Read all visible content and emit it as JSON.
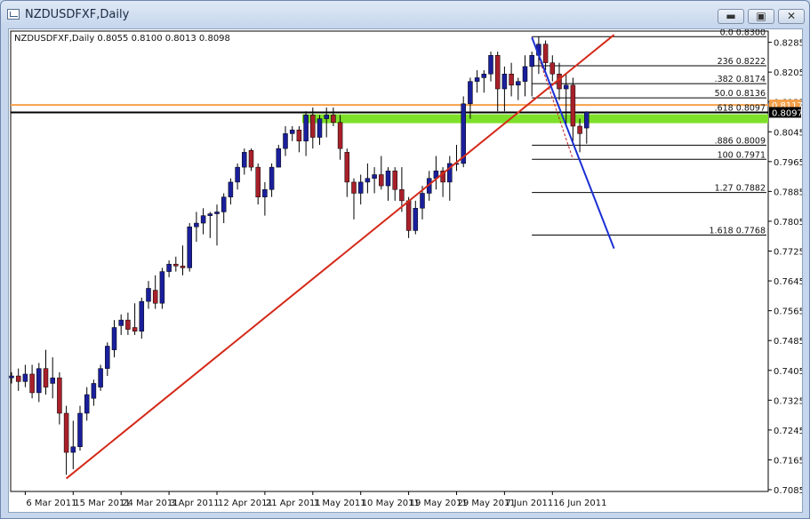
{
  "window": {
    "title": "NZDUSDFXF,Daily",
    "minimize_label": "▬",
    "restore_label": "▣",
    "close_label": "✕"
  },
  "chart_data": {
    "type": "candlestick",
    "header": "NZDUSDFXF,Daily  0.8055 0.8100 0.8013 0.8098",
    "symbol": "NZDUSDFXF",
    "timeframe": "Daily",
    "ylim": [
      0.7085,
      0.8315
    ],
    "y_ticks": [
      0.8285,
      0.8205,
      0.8125,
      0.8045,
      0.7965,
      0.7885,
      0.7805,
      0.7725,
      0.7645,
      0.7565,
      0.7485,
      0.7405,
      0.7325,
      0.7245,
      0.7165,
      0.7085
    ],
    "x_labels": [
      {
        "idx": 2,
        "label": "6 Mar 2011"
      },
      {
        "idx": 9,
        "label": "15 Mar 2011"
      },
      {
        "idx": 16,
        "label": "24 Mar 2011"
      },
      {
        "idx": 23,
        "label": "3 Apr 2011"
      },
      {
        "idx": 30,
        "label": "12 Apr 2011"
      },
      {
        "idx": 37,
        "label": "21 Apr 2011"
      },
      {
        "idx": 44,
        "label": "1 May 2011"
      },
      {
        "idx": 51,
        "label": "10 May 2011"
      },
      {
        "idx": 58,
        "label": "19 May 2011"
      },
      {
        "idx": 65,
        "label": "29 May 2011"
      },
      {
        "idx": 72,
        "label": "7 Jun 2011"
      },
      {
        "idx": 79,
        "label": "16 Jun 2011"
      }
    ],
    "candles": [
      [
        0.7385,
        0.74,
        0.737,
        0.739
      ],
      [
        0.739,
        0.741,
        0.735,
        0.7375
      ],
      [
        0.7375,
        0.742,
        0.736,
        0.7395
      ],
      [
        0.7395,
        0.742,
        0.733,
        0.7345
      ],
      [
        0.7345,
        0.7425,
        0.732,
        0.741
      ],
      [
        0.741,
        0.746,
        0.734,
        0.736
      ],
      [
        0.737,
        0.744,
        0.733,
        0.7385
      ],
      [
        0.7385,
        0.74,
        0.726,
        0.729
      ],
      [
        0.729,
        0.731,
        0.7125,
        0.7185
      ],
      [
        0.7185,
        0.727,
        0.714,
        0.72
      ],
      [
        0.72,
        0.731,
        0.719,
        0.729
      ],
      [
        0.729,
        0.736,
        0.727,
        0.734
      ],
      [
        0.733,
        0.738,
        0.731,
        0.737
      ],
      [
        0.736,
        0.742,
        0.735,
        0.741
      ],
      [
        0.741,
        0.748,
        0.739,
        0.747
      ],
      [
        0.746,
        0.754,
        0.744,
        0.752
      ],
      [
        0.7525,
        0.7555,
        0.75,
        0.754
      ],
      [
        0.754,
        0.756,
        0.75,
        0.7515
      ],
      [
        0.752,
        0.7585,
        0.75,
        0.751
      ],
      [
        0.751,
        0.76,
        0.749,
        0.759
      ],
      [
        0.759,
        0.7645,
        0.757,
        0.7625
      ],
      [
        0.762,
        0.766,
        0.757,
        0.7585
      ],
      [
        0.7585,
        0.768,
        0.757,
        0.767
      ],
      [
        0.767,
        0.77,
        0.7655,
        0.769
      ],
      [
        0.769,
        0.771,
        0.767,
        0.7685
      ],
      [
        0.7685,
        0.774,
        0.766,
        0.768
      ],
      [
        0.768,
        0.78,
        0.767,
        0.779
      ],
      [
        0.779,
        0.783,
        0.775,
        0.78
      ],
      [
        0.78,
        0.784,
        0.777,
        0.782
      ],
      [
        0.782,
        0.783,
        0.776,
        0.7825
      ],
      [
        0.7825,
        0.785,
        0.774,
        0.783
      ],
      [
        0.783,
        0.788,
        0.78,
        0.787
      ],
      [
        0.787,
        0.792,
        0.785,
        0.791
      ],
      [
        0.791,
        0.796,
        0.789,
        0.795
      ],
      [
        0.795,
        0.8,
        0.793,
        0.799
      ],
      [
        0.7995,
        0.8,
        0.794,
        0.795
      ],
      [
        0.795,
        0.796,
        0.785,
        0.787
      ],
      [
        0.787,
        0.791,
        0.782,
        0.789
      ],
      [
        0.789,
        0.796,
        0.787,
        0.795
      ],
      [
        0.795,
        0.801,
        0.795,
        0.8
      ],
      [
        0.8,
        0.806,
        0.798,
        0.804
      ],
      [
        0.804,
        0.806,
        0.802,
        0.805
      ],
      [
        0.805,
        0.806,
        0.799,
        0.802
      ],
      [
        0.802,
        0.81,
        0.798,
        0.809
      ],
      [
        0.809,
        0.811,
        0.8,
        0.803
      ],
      [
        0.803,
        0.809,
        0.801,
        0.808
      ],
      [
        0.808,
        0.811,
        0.803,
        0.809
      ],
      [
        0.809,
        0.811,
        0.806,
        0.807
      ],
      [
        0.807,
        0.809,
        0.797,
        0.8
      ],
      [
        0.799,
        0.8,
        0.787,
        0.791
      ],
      [
        0.791,
        0.792,
        0.781,
        0.788
      ],
      [
        0.788,
        0.793,
        0.785,
        0.791
      ],
      [
        0.791,
        0.796,
        0.788,
        0.792
      ],
      [
        0.792,
        0.795,
        0.788,
        0.793
      ],
      [
        0.793,
        0.798,
        0.789,
        0.79
      ],
      [
        0.79,
        0.795,
        0.786,
        0.794
      ],
      [
        0.794,
        0.795,
        0.786,
        0.789
      ],
      [
        0.789,
        0.795,
        0.783,
        0.786
      ],
      [
        0.786,
        0.787,
        0.776,
        0.778
      ],
      [
        0.778,
        0.786,
        0.777,
        0.784
      ],
      [
        0.784,
        0.79,
        0.781,
        0.788
      ],
      [
        0.788,
        0.794,
        0.786,
        0.792
      ],
      [
        0.792,
        0.798,
        0.789,
        0.794
      ],
      [
        0.794,
        0.795,
        0.787,
        0.791
      ],
      [
        0.791,
        0.798,
        0.786,
        0.796
      ],
      [
        0.796,
        0.801,
        0.794,
        0.796
      ],
      [
        0.796,
        0.814,
        0.795,
        0.812
      ],
      [
        0.812,
        0.819,
        0.808,
        0.818
      ],
      [
        0.818,
        0.821,
        0.815,
        0.819
      ],
      [
        0.819,
        0.821,
        0.815,
        0.82
      ],
      [
        0.82,
        0.826,
        0.818,
        0.825
      ],
      [
        0.825,
        0.826,
        0.81,
        0.816
      ],
      [
        0.816,
        0.822,
        0.81,
        0.82
      ],
      [
        0.82,
        0.823,
        0.814,
        0.817
      ],
      [
        0.817,
        0.819,
        0.813,
        0.818
      ],
      [
        0.818,
        0.825,
        0.814,
        0.822
      ],
      [
        0.822,
        0.826,
        0.814,
        0.825
      ],
      [
        0.825,
        0.83,
        0.82,
        0.828
      ],
      [
        0.828,
        0.829,
        0.821,
        0.823
      ],
      [
        0.823,
        0.825,
        0.818,
        0.82
      ],
      [
        0.82,
        0.823,
        0.813,
        0.816
      ],
      [
        0.816,
        0.82,
        0.806,
        0.817
      ],
      [
        0.817,
        0.819,
        0.802,
        0.806
      ],
      [
        0.806,
        0.808,
        0.799,
        0.804
      ],
      [
        0.8055,
        0.81,
        0.8013,
        0.8098
      ]
    ],
    "horizontal_lines": [
      {
        "price": 0.8117,
        "color": "#f5a04a",
        "label": "0.8117"
      },
      {
        "price": 0.8097,
        "color": "#000000",
        "label": "0.8097"
      }
    ],
    "zone": {
      "top": 0.8092,
      "bottom": 0.8068,
      "color": "#7fe02a"
    },
    "trendlines": [
      {
        "color": "#d42a1a",
        "from": [
          8,
          0.7115
        ],
        "to": [
          88,
          0.8305
        ]
      },
      {
        "color": "#1a2fd4",
        "from": [
          76,
          0.8298
        ],
        "to": [
          88,
          0.7732
        ]
      }
    ],
    "fibonacci": {
      "levels": [
        {
          "ratio": "0.0",
          "price": "0.8300"
        },
        {
          "ratio": "23.6",
          "price": "0.8222"
        },
        {
          "ratio": "38.2",
          "price": "0.8174"
        },
        {
          "ratio": "50.0",
          "price": "0.8136"
        },
        {
          "ratio": "61.8",
          "price": "0.8097"
        },
        {
          "ratio": "88.6",
          "price": "0.8009"
        },
        {
          "ratio": "100",
          "price": "0.7971"
        },
        {
          "ratio": "1.27",
          "price": "0.7882"
        },
        {
          "ratio": "1.618",
          "price": "0.7768"
        }
      ],
      "display": [
        "0.0",
        "236",
        ".382",
        "50.0",
        ".618",
        ".886",
        "100",
        "1.27",
        "1.618"
      ]
    },
    "colors": {
      "bull": "#1a1f9c",
      "bear": "#a8202a",
      "axis": "#000000"
    }
  }
}
